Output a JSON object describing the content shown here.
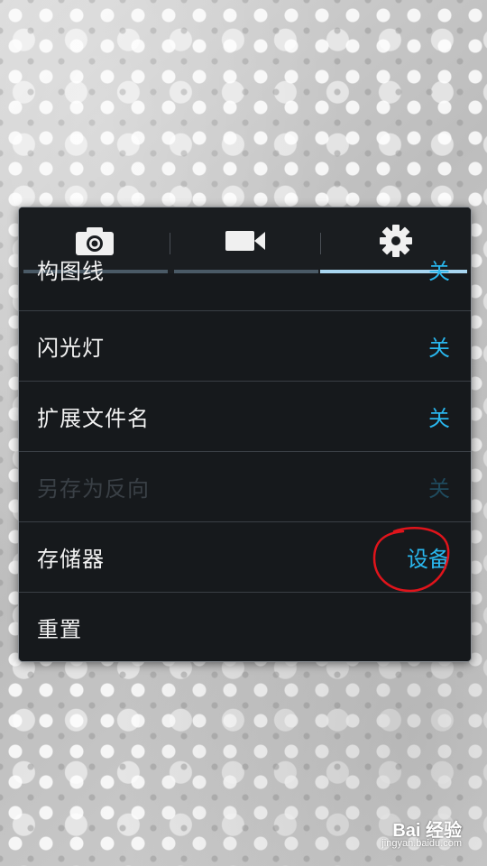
{
  "tabs": [
    {
      "label": "camera",
      "icon": "camera-icon"
    },
    {
      "label": "video",
      "icon": "video-camera-icon"
    },
    {
      "label": "settings",
      "icon": "gear-icon",
      "selected": true
    }
  ],
  "settings_list": [
    {
      "label": "构图线",
      "value": "关",
      "state": "partially-scrolled"
    },
    {
      "label": "闪光灯",
      "value": "关"
    },
    {
      "label": "扩展文件名",
      "value": "关"
    },
    {
      "label": "另存为反向",
      "value": "关",
      "state": "disabled"
    },
    {
      "label": "存储器",
      "value": "设备",
      "annotated": true
    },
    {
      "label": "重置",
      "value": ""
    }
  ],
  "colors": {
    "accent": "#29b7ee",
    "selected_tab_indicator": "#a8d6f0",
    "annotation": "#e0141b",
    "panel_background": "#16191c"
  },
  "watermark": {
    "main": "Bai 经验",
    "sub": "jingyan.baidu.com"
  }
}
